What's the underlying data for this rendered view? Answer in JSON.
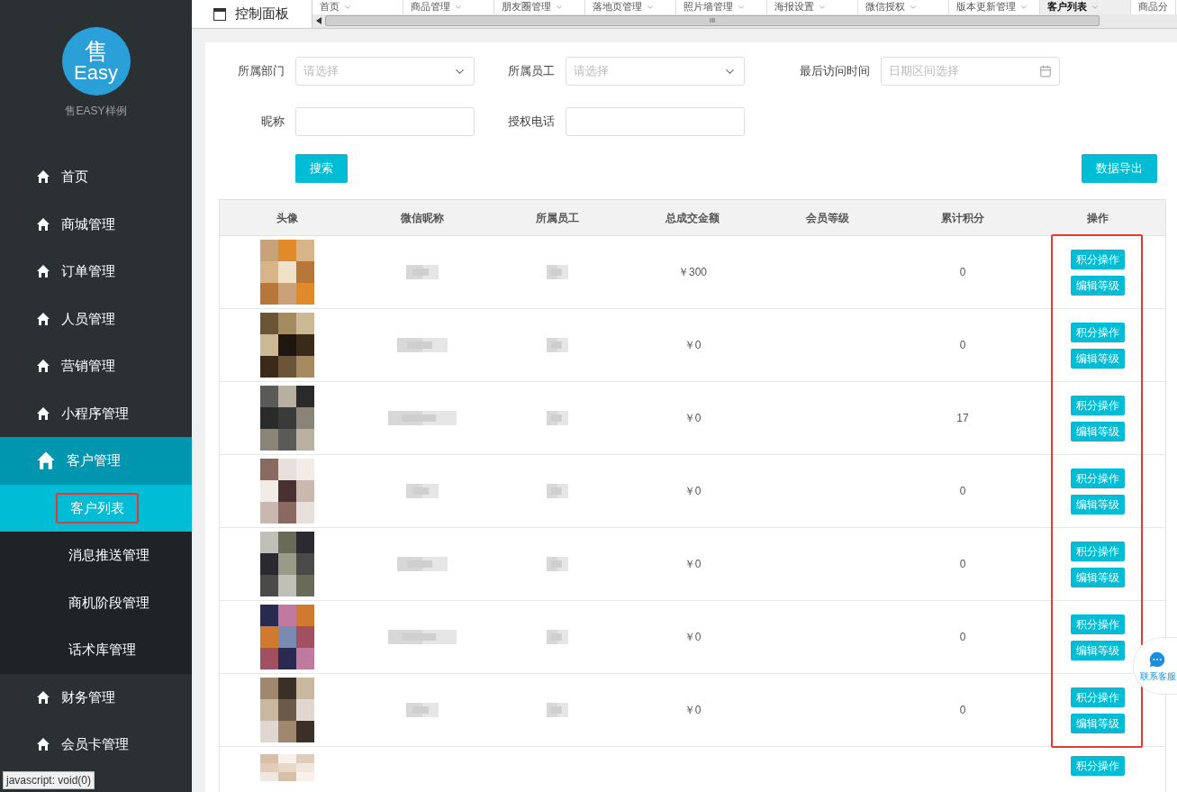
{
  "sidebar": {
    "logo": {
      "glyph": "售",
      "text": "Easy"
    },
    "brand": "售EASY样例",
    "items": [
      {
        "label": "首页",
        "selected": false
      },
      {
        "label": "商城管理",
        "selected": false
      },
      {
        "label": "订单管理",
        "selected": false
      },
      {
        "label": "人员管理",
        "selected": false
      },
      {
        "label": "营销管理",
        "selected": false
      },
      {
        "label": "小程序管理",
        "selected": false
      },
      {
        "label": "客户管理",
        "selected": true,
        "children": [
          {
            "label": "客户列表",
            "selected": true
          },
          {
            "label": "消息推送管理",
            "selected": false
          },
          {
            "label": "商机阶段管理",
            "selected": false
          },
          {
            "label": "话术库管理",
            "selected": false
          }
        ]
      },
      {
        "label": "财务管理",
        "selected": false
      },
      {
        "label": "会员卡管理",
        "selected": false
      }
    ]
  },
  "status_bar": "javascript: void(0)",
  "tab_bar": {
    "home": "控制面板",
    "tabs": [
      {
        "label": "首页",
        "selected": false
      },
      {
        "label": "商品管理",
        "selected": false
      },
      {
        "label": "朋友圈管理",
        "selected": false
      },
      {
        "label": "落地页管理",
        "selected": false
      },
      {
        "label": "照片墙管理",
        "selected": false
      },
      {
        "label": "海报设置",
        "selected": false
      },
      {
        "label": "微信授权",
        "selected": false
      },
      {
        "label": "版本更新管理",
        "selected": false
      },
      {
        "label": "客户列表",
        "selected": true
      },
      {
        "label": "商品分",
        "selected": false
      }
    ],
    "scroll_grip": "III"
  },
  "filters": [
    {
      "label": "所属部门",
      "kind": "select",
      "placeholder": "请选择"
    },
    {
      "label": "所属员工",
      "kind": "select",
      "placeholder": "请选择"
    },
    {
      "label": "最后访问时间",
      "kind": "date",
      "placeholder": "日期区间选择"
    },
    {
      "label": "昵称",
      "kind": "text"
    },
    {
      "label": "授权电话",
      "kind": "text"
    }
  ],
  "search_button": "搜索",
  "export_button": "数据导出",
  "table": {
    "columns": [
      "头像",
      "微信昵称",
      "所属员工",
      "总成交金额",
      "会员等级",
      "累计积分",
      "操作"
    ],
    "rows": [
      {
        "amount": "￥300",
        "points": "0",
        "actions": [
          "积分操作",
          "编辑等级"
        ]
      },
      {
        "amount": "￥0",
        "points": "0",
        "actions": [
          "积分操作",
          "编辑等级"
        ]
      },
      {
        "amount": "￥0",
        "points": "17",
        "actions": [
          "积分操作",
          "编辑等级"
        ]
      },
      {
        "amount": "￥0",
        "points": "0",
        "actions": [
          "积分操作",
          "编辑等级"
        ]
      },
      {
        "amount": "￥0",
        "points": "0",
        "actions": [
          "积分操作",
          "编辑等级"
        ]
      },
      {
        "amount": "￥0",
        "points": "0",
        "actions": [
          "积分操作",
          "编辑等级"
        ]
      },
      {
        "amount": "￥0",
        "points": "0",
        "actions": [
          "积分操作",
          "编辑等级"
        ]
      },
      {
        "actions": [
          "积分操作"
        ]
      }
    ]
  },
  "float_service": "联系客服"
}
